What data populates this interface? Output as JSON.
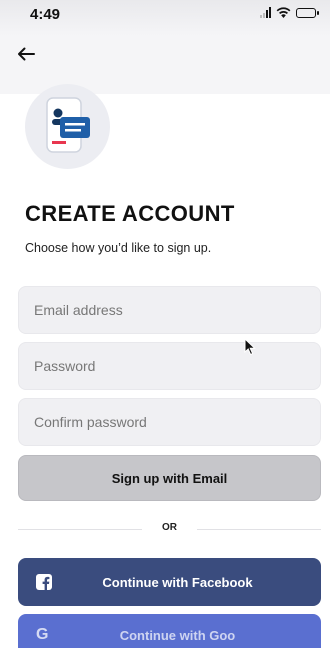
{
  "status_bar": {
    "time": "4:49",
    "icons": [
      "signal-icon",
      "wifi-icon",
      "battery-icon"
    ]
  },
  "header": {
    "back_icon": "arrow-left-icon"
  },
  "illustration": {
    "icon": "phone-id-card-icon",
    "colors": {
      "circle": "#ecedf2",
      "accent_blue": "#1f5fa8",
      "accent_red": "#e8364f",
      "navy": "#14365f"
    }
  },
  "title": "CREATE ACCOUNT",
  "subtitle": "Choose how you’d like to sign up.",
  "form": {
    "email": {
      "placeholder": "Email address",
      "value": ""
    },
    "password": {
      "placeholder": "Password",
      "value": ""
    },
    "confirm_password": {
      "placeholder": "Confirm password",
      "value": ""
    }
  },
  "buttons": {
    "email_signup": {
      "label": "Sign up with Email",
      "color": "#c6c6ca"
    },
    "divider_text": "OR",
    "facebook": {
      "label": "Continue with Facebook",
      "icon": "facebook-icon",
      "color": "#3a4c7e"
    },
    "google": {
      "label": "Continue with Goo",
      "icon": "google-icon",
      "color": "#5a6fd0"
    }
  },
  "cursor": {
    "icon": "mouse-pointer-icon"
  }
}
